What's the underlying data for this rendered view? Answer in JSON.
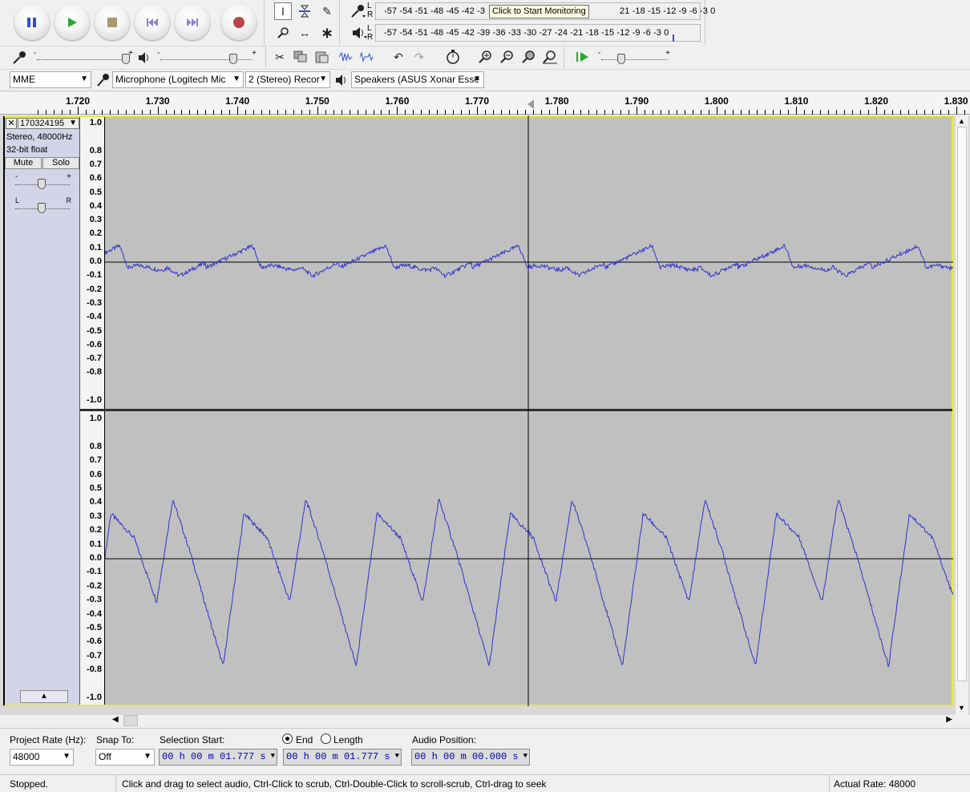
{
  "transport": {
    "pause_label": "Pause",
    "play_label": "Play",
    "stop_label": "Stop",
    "skip_start_label": "Skip to Start",
    "skip_end_label": "Skip to End",
    "record_label": "Record"
  },
  "meters": {
    "rec_scale": "-57 -54 -51 -48 -45 -42 -3",
    "rec_scale_right": "21 -18 -15 -12 -9 -6 -3 0",
    "rec_tooltip": "Click to Start Monitoring",
    "play_scale": "-57 -54 -51 -48 -45 -42 -39 -36 -33 -30 -27 -24 -21 -18 -15 -12 -9 -6 -3 0",
    "lr_top": "L",
    "lr_bottom": "R"
  },
  "mixer": {
    "minus": "-",
    "plus": "+"
  },
  "device": {
    "host": "MME",
    "mic": "Microphone (Logitech Mic",
    "channels": "2 (Stereo) Recor",
    "speakers": "Speakers (ASUS Xonar Esse"
  },
  "ruler": {
    "labels": [
      "1.720",
      "1.730",
      "1.740",
      "1.750",
      "1.760",
      "1.770",
      "1.780",
      "1.790",
      "1.800",
      "1.810",
      "1.820",
      "1.830"
    ]
  },
  "track": {
    "name": "170324195",
    "info1": "Stereo, 48000Hz",
    "info2": "32-bit float",
    "mute": "Mute",
    "solo": "Solo",
    "gain_minus": "-",
    "gain_plus": "+",
    "pan_l": "L",
    "pan_r": "R",
    "close": "✕",
    "menu_arrow": "▼",
    "collapse": "▲"
  },
  "amplitude_labels": [
    "1.0",
    "0.8",
    "0.7",
    "0.6",
    "0.5",
    "0.4",
    "0.3",
    "0.2",
    "0.1",
    "0.0",
    "-0.1",
    "-0.2",
    "-0.3",
    "-0.4",
    "-0.5",
    "-0.6",
    "-0.7",
    "-0.8",
    "-1.0"
  ],
  "selection": {
    "project_rate_label": "Project Rate (Hz):",
    "project_rate": "48000",
    "snap_label": "Snap To:",
    "snap_value": "Off",
    "sel_start_label": "Selection Start:",
    "end_label": "End",
    "length_label": "Length",
    "audio_pos_label": "Audio Position:",
    "sel_start": "00 h 00 m 01.777 s",
    "sel_end": "00 h 00 m 01.777 s",
    "audio_pos": "00 h 00 m 00.000 s"
  },
  "status": {
    "state": "Stopped.",
    "hint": "Click and drag to select audio, Ctrl-Click to scrub, Ctrl-Double-Click to scroll-scrub, Ctrl-drag to seek",
    "rate": "Actual Rate: 48000"
  },
  "colors": {
    "waveform": "#3232c8",
    "track_bg": "#c0c0c0",
    "selection_yellow": "#e8e84a",
    "trackinfo_bg": "#d4d4e8",
    "record_red": "#b8464a",
    "play_green": "#2ea82e",
    "pause_blue": "#3050d0"
  }
}
